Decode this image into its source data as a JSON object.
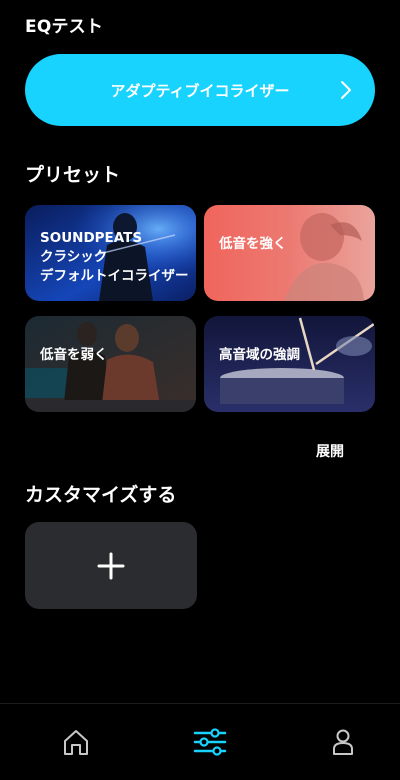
{
  "header": {
    "title": "EQテスト"
  },
  "adaptive": {
    "label": "アダプティブイコライザー",
    "chevron_icon": "chevron-right-icon"
  },
  "presets": {
    "title": "プリセット",
    "items": [
      {
        "lines": [
          "SOUNDPEATS",
          "クラシック",
          "デフォルトイコライザー"
        ]
      },
      {
        "lines": [
          "低音を強く"
        ]
      },
      {
        "lines": [
          "低音を弱く"
        ]
      },
      {
        "lines": [
          "高音域の強調"
        ]
      }
    ],
    "expand_label": "展開"
  },
  "custom": {
    "title": "カスタマイズする",
    "add_icon": "plus-icon"
  },
  "tabbar": {
    "items": [
      {
        "icon": "home-icon",
        "active": false
      },
      {
        "icon": "equalizer-sliders-icon",
        "active": true
      },
      {
        "icon": "profile-icon",
        "active": false
      }
    ]
  },
  "colors": {
    "background": "#000000",
    "accent": "#19d3ff",
    "card": "#2b2c30",
    "inactive_icon": "#c8c8c8"
  }
}
